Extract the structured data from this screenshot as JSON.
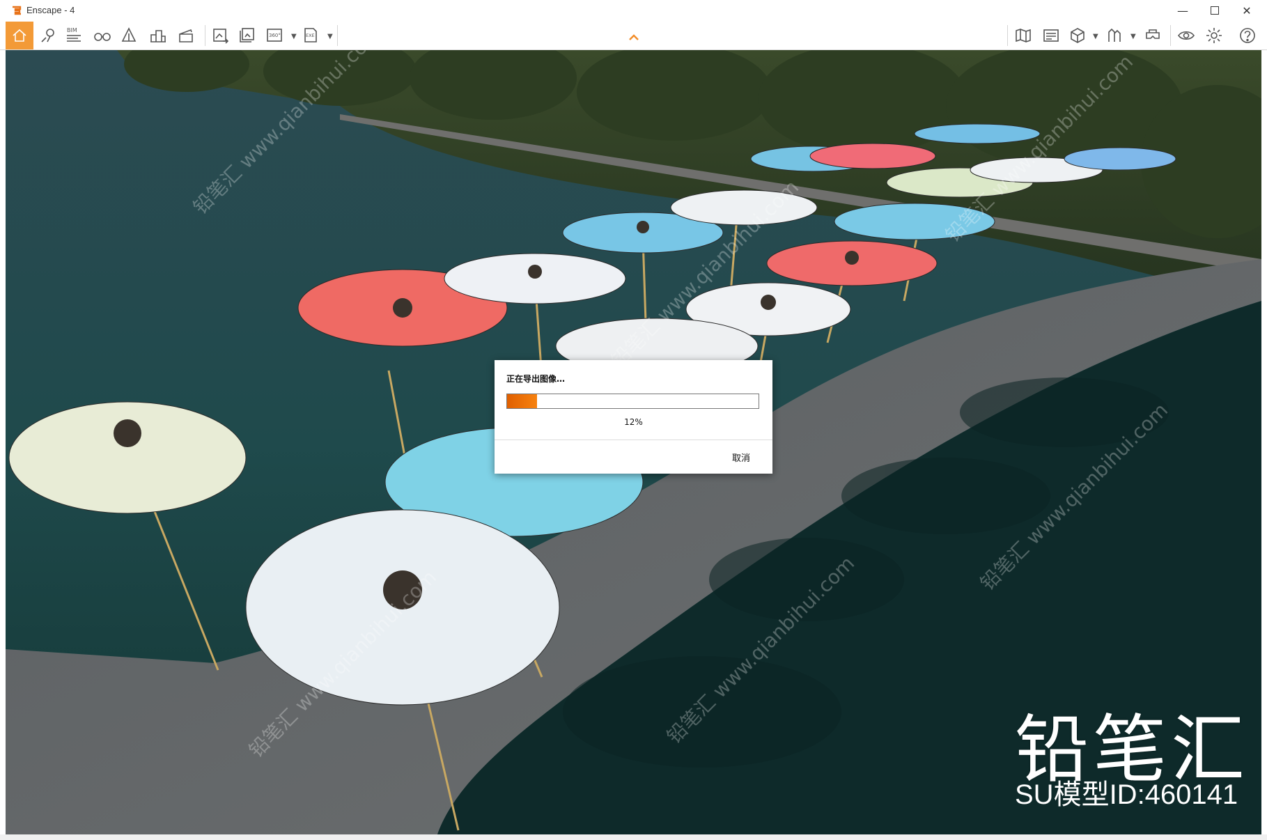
{
  "window": {
    "title": "Enscape - 4"
  },
  "toolbar": {
    "bim_label": "BIM",
    "pano_label": "360°",
    "exe_label": "EXE"
  },
  "dialog": {
    "title": "正在导出图像…",
    "progress": 0.12,
    "progress_text": "12%",
    "cancel_label": "取消"
  },
  "watermark": {
    "brand": "铅笔汇",
    "model_id": "SU模型ID:460141",
    "diagonal": "铅笔汇 www.qianbihui.com"
  },
  "colors": {
    "accent": "#f39a37",
    "progress": "#f7820f"
  }
}
